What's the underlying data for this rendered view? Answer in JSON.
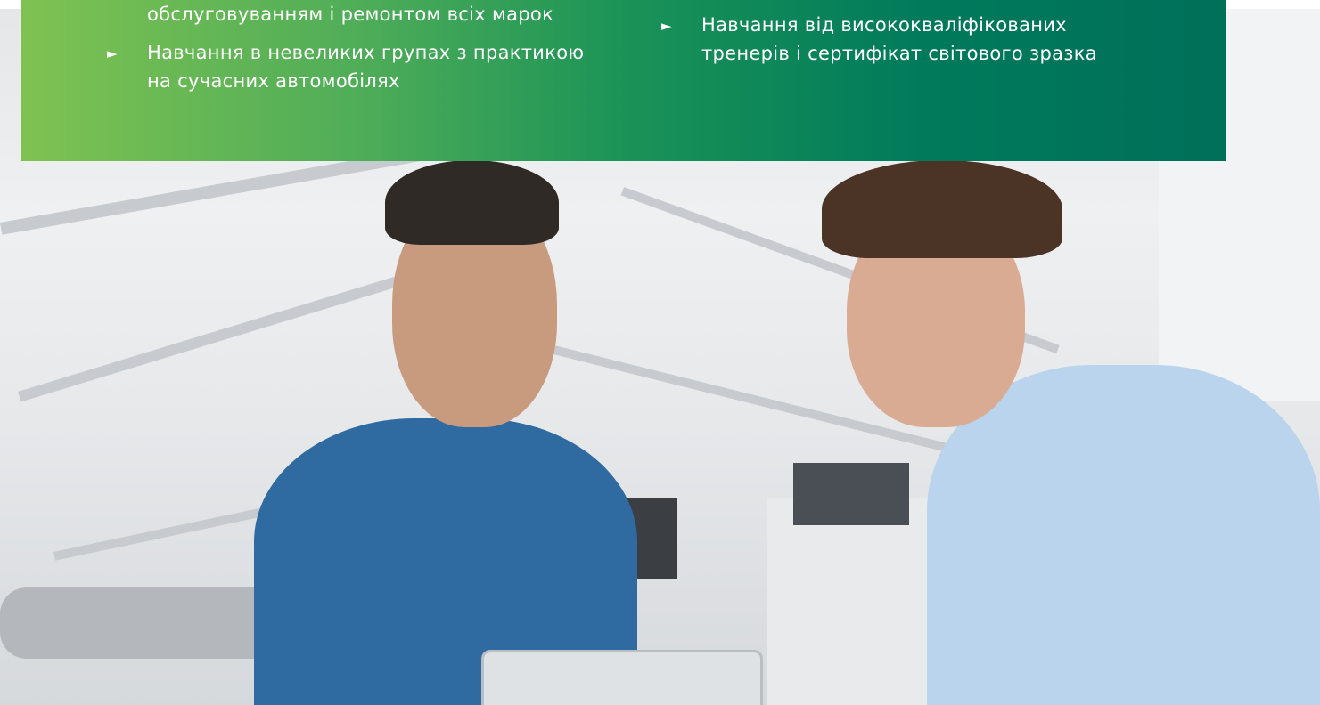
{
  "banner": {
    "column1": {
      "continued_line": "обслуговуванням і ремонтом всіх марок",
      "items": [
        {
          "line1": "Навчання в невеликих групах з практикою",
          "line2": "на сучасних автомобілях"
        }
      ]
    },
    "column2": {
      "items": [
        {
          "line1": "Навчання від висококваліфікованих",
          "line2": "тренерів і сертифікат світового зразка"
        }
      ]
    },
    "bullet_glyph": "►",
    "colors": {
      "start": "#7fc252",
      "end": "#006f59",
      "text": "#ffffff"
    }
  },
  "photo": {
    "icon": "workshop-photo-icon"
  }
}
